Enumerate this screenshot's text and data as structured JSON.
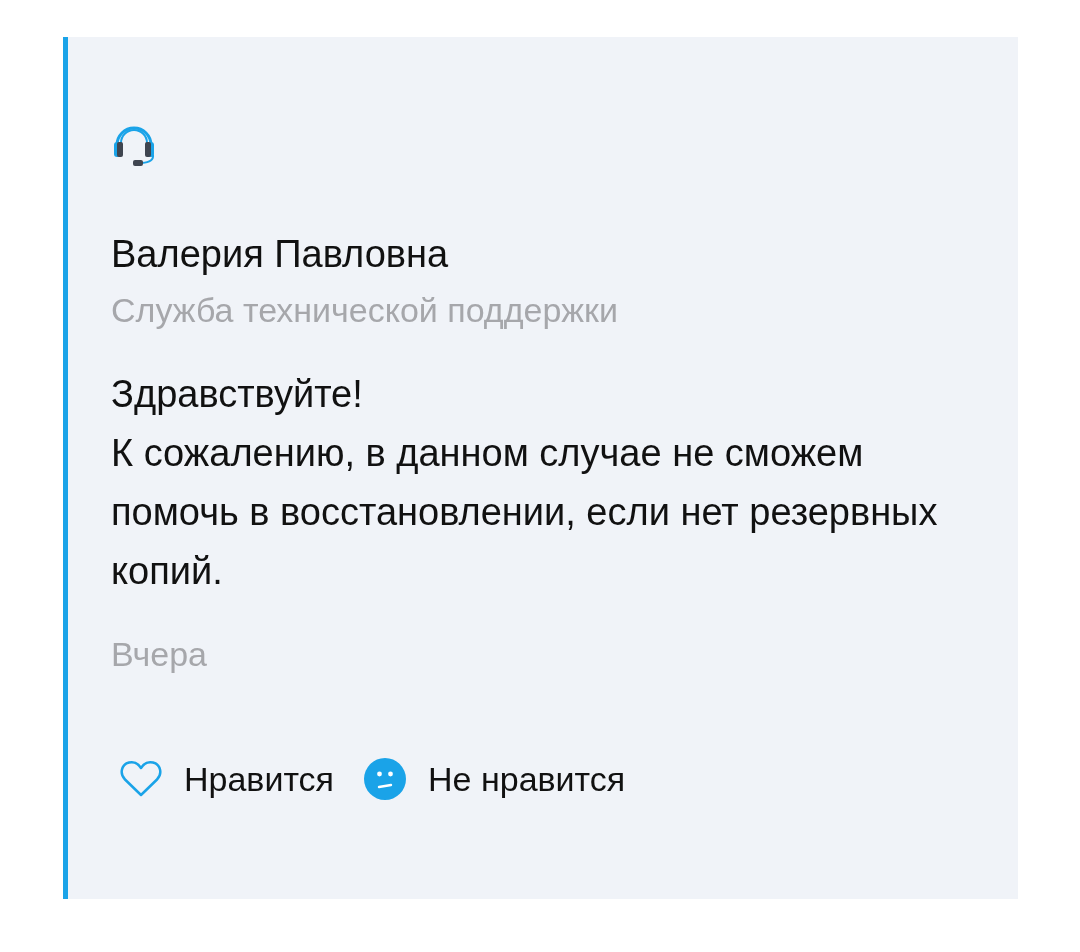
{
  "message": {
    "author": "Валерия Павловна",
    "role": "Служба технической поддержки",
    "paragraphs": [
      "Здравствуйте!",
      "К сожалению, в данном случае не сможем помочь в восстановлении, если нет резервных копий."
    ],
    "time": "Вчера"
  },
  "reactions": [
    {
      "kind": "like",
      "label": "Нравится"
    },
    {
      "kind": "dislike",
      "label": "Не нравится"
    }
  ]
}
